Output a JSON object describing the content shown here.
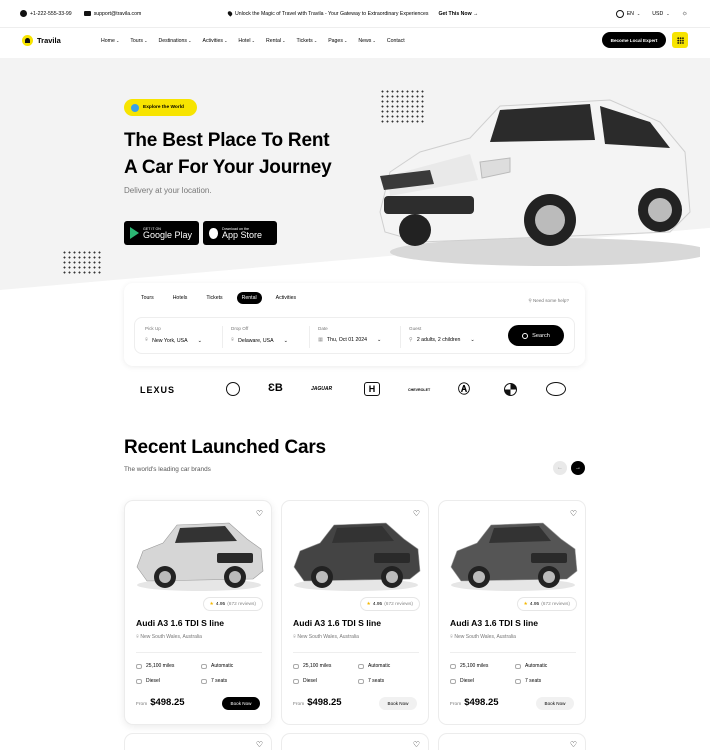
{
  "topbar": {
    "phone": "+1-222-555-33-99",
    "email": "support@travila.com",
    "promo": "Unlock the Magic of Travel with Travila - Your Gateway to Extraordinary Experiences",
    "promo_cta": "Get This Now →",
    "language": "EN",
    "currency": "USD"
  },
  "nav": {
    "brand": "Travila",
    "items": [
      "Home",
      "Tours",
      "Destinations",
      "Activities",
      "Hotel",
      "Rental",
      "Tickets",
      "Pages",
      "News",
      "Contact"
    ],
    "cta": "Become Local Expert"
  },
  "hero": {
    "badge": "Explore the World",
    "title_line1": "The Best Place To Rent",
    "title_line2": "A Car For Your Journey",
    "subtitle": "Delivery at your location.",
    "google_small": "GET IT ON",
    "google_big": "Google Play",
    "apple_small": "Download on the",
    "apple_big": "App Store"
  },
  "search": {
    "tabs": [
      "Tours",
      "Hotels",
      "Tickets",
      "Rental",
      "Activities"
    ],
    "active_tab": "Rental",
    "help": "Need some help?",
    "fields": [
      {
        "label": "Pick Up",
        "value": "New York, USA"
      },
      {
        "label": "Drop Off",
        "value": "Delaware, USA"
      },
      {
        "label": "Date",
        "value": "Thu, Oct 01 2024"
      },
      {
        "label": "Guest",
        "value": "2 adults, 2 children"
      }
    ],
    "button": "Search"
  },
  "brands": [
    "LEXUS",
    "Mercedes",
    "Bugatti",
    "JAGUAR",
    "Honda",
    "CHEVROLET",
    "ACURA",
    "BMW",
    "Toyota"
  ],
  "section": {
    "title": "Recent Launched Cars",
    "subtitle": "The world's leading car brands"
  },
  "cars": [
    {
      "name": "Audi A3 1.6 TDI S line",
      "location": "New South Wales, Australia",
      "rating": "4.95",
      "reviews": "(672 reviews)",
      "miles": "25,100 miles",
      "transmission": "Automatic",
      "fuel": "Diesel",
      "seats": "7 seats",
      "from": "From",
      "price": "$498.25",
      "book": "Book Now",
      "color": "#d6d6d6"
    },
    {
      "name": "Audi A3 1.6 TDI S line",
      "location": "New South Wales, Australia",
      "rating": "4.95",
      "reviews": "(672 reviews)",
      "miles": "25,100 miles",
      "transmission": "Automatic",
      "fuel": "Diesel",
      "seats": "7 seats",
      "from": "From",
      "price": "$498.25",
      "book": "Book Now",
      "color": "#444444"
    },
    {
      "name": "Audi A3 1.6 TDI S line",
      "location": "New South Wales, Australia",
      "rating": "4.95",
      "reviews": "(672 reviews)",
      "miles": "25,100 miles",
      "transmission": "Automatic",
      "fuel": "Diesel",
      "seats": "7 seats",
      "from": "From",
      "price": "$498.25",
      "book": "Book Now",
      "color": "#555555"
    }
  ],
  "colors": {
    "accent": "#f7e400",
    "dark": "#000000"
  }
}
